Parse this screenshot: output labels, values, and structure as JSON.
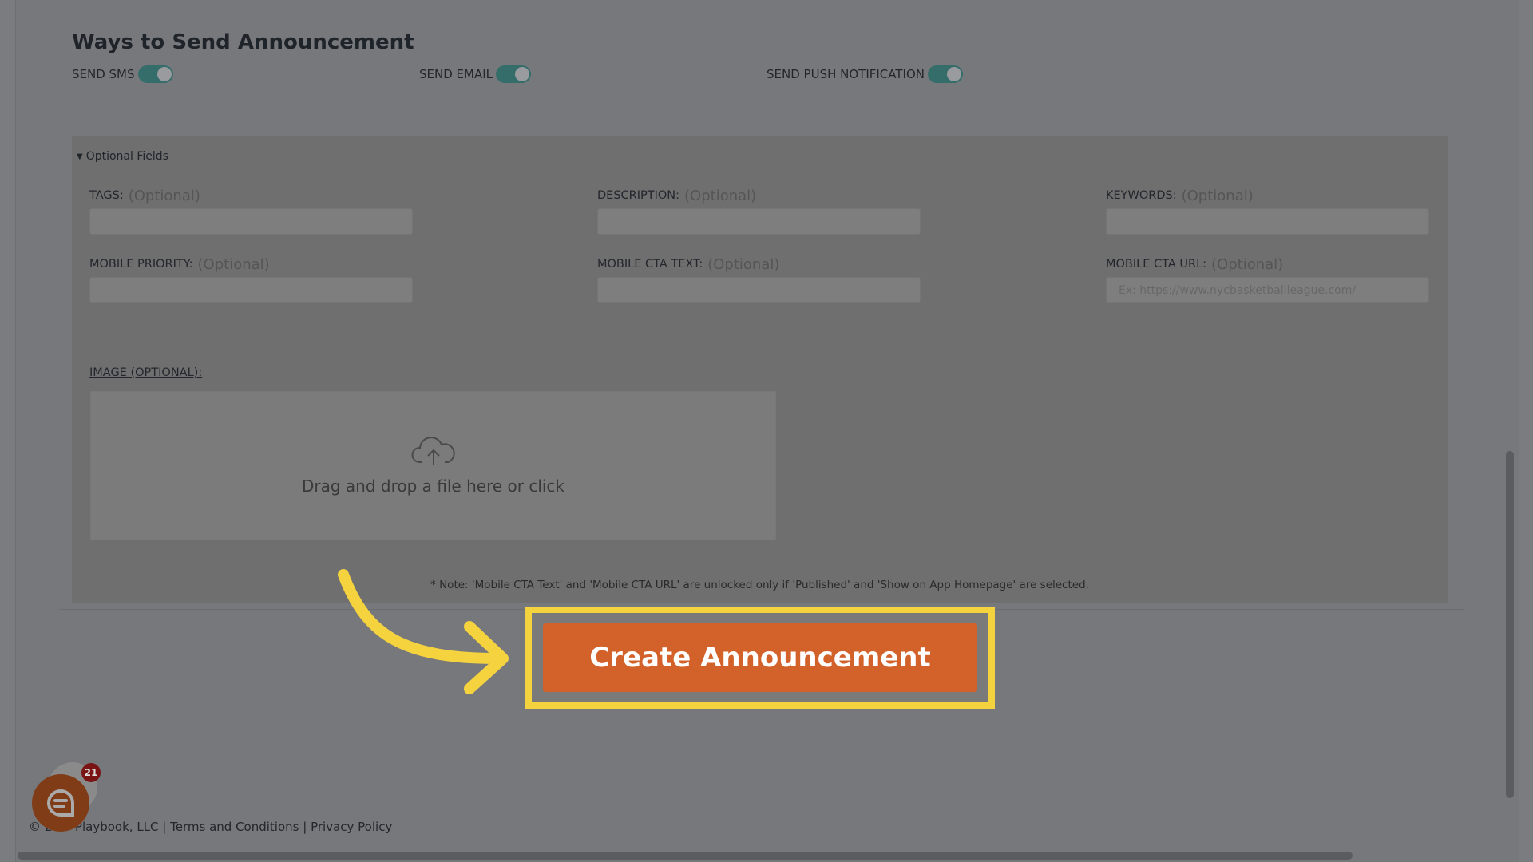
{
  "section_title": "Ways to Send Announcement",
  "toggles": [
    {
      "label": "SEND SMS",
      "on": true
    },
    {
      "label": "SEND EMAIL",
      "on": true
    },
    {
      "label": "SEND PUSH NOTIFICATION",
      "on": true
    }
  ],
  "optional_fields": {
    "toggle_label": "Optional Fields",
    "optional_hint": "(Optional)",
    "fields": [
      {
        "label": "TAGS:",
        "value": "",
        "placeholder": ""
      },
      {
        "label": "DESCRIPTION:",
        "value": "",
        "placeholder": ""
      },
      {
        "label": "KEYWORDS:",
        "value": "",
        "placeholder": ""
      },
      {
        "label": "MOBILE PRIORITY:",
        "value": "",
        "placeholder": ""
      },
      {
        "label": "MOBILE CTA TEXT:",
        "value": "",
        "placeholder": ""
      },
      {
        "label": "MOBILE CTA URL:",
        "value": "",
        "placeholder": "Ex: https://www.nycbasketballleague.com/"
      }
    ],
    "image_label": "IMAGE (OPTIONAL):",
    "dropzone_text": "Drag and drop a file here or click",
    "note": "* Note: 'Mobile CTA Text' and 'Mobile CTA URL' are unlocked only if 'Published' and 'Show on App Homepage' are selected."
  },
  "create_button": "Create Announcement",
  "footer": {
    "copyright": "© 20",
    "company": "Playbook, LLC",
    "sep": "|",
    "terms": "Terms and Conditions",
    "privacy": "Privacy Policy"
  },
  "chat": {
    "badge_count": "21"
  },
  "colors": {
    "accent": "#d2612a",
    "highlight": "#f5d33f",
    "toggle": "#356d6b"
  }
}
